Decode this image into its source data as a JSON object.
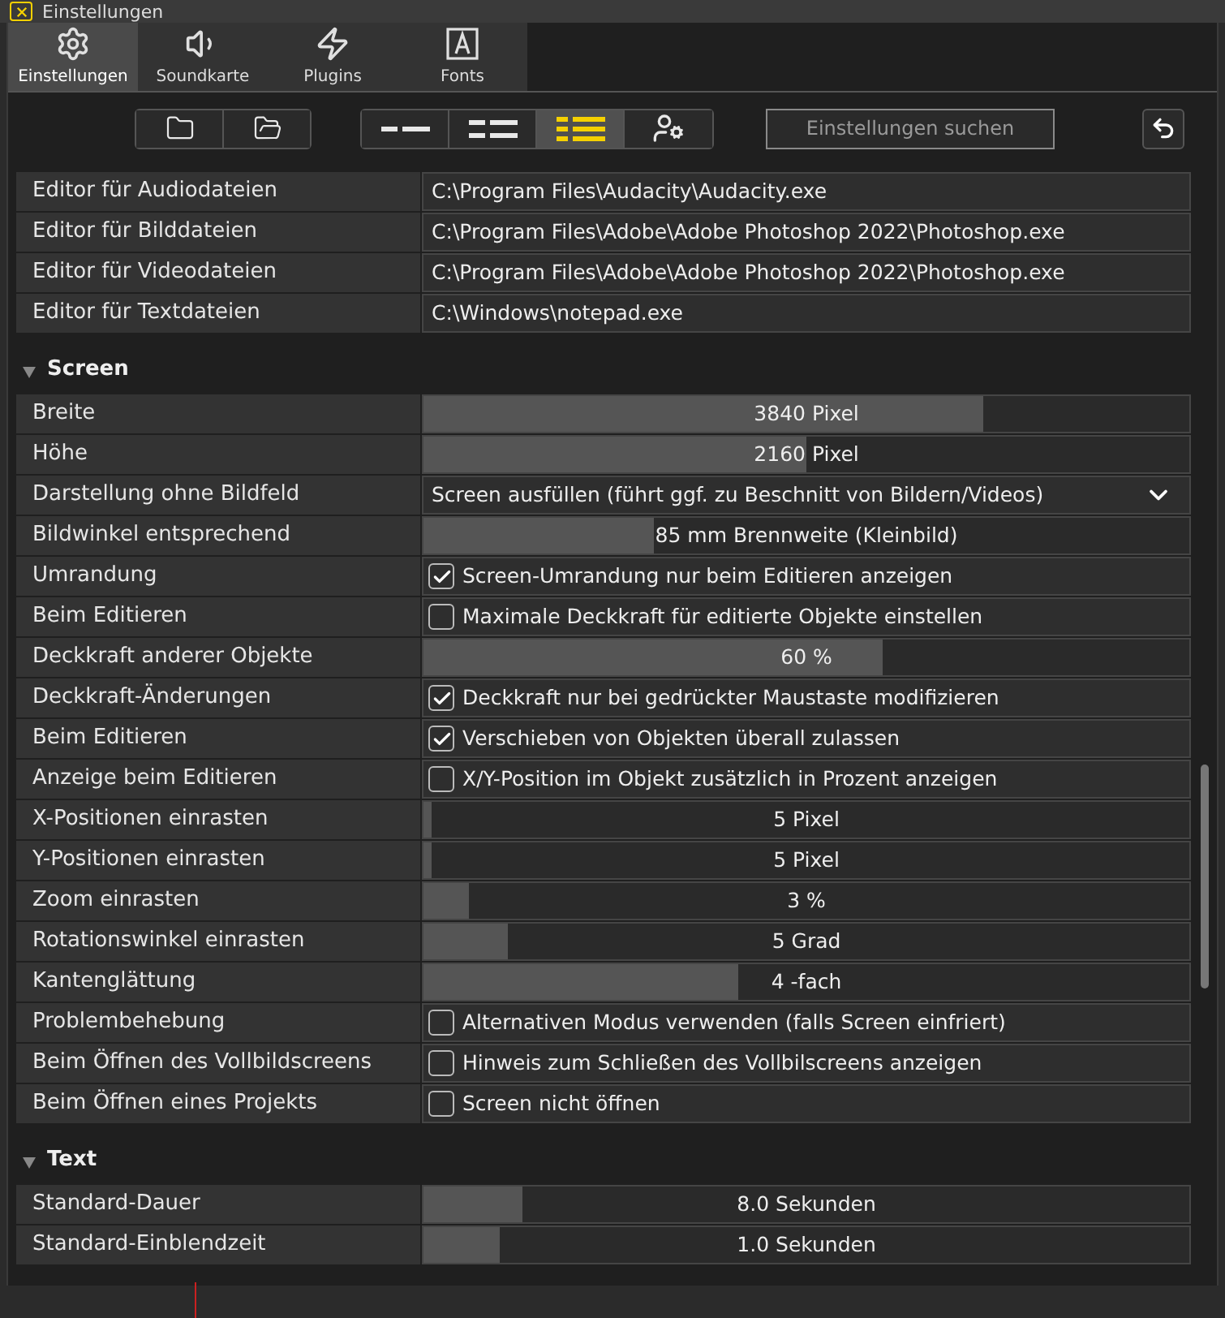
{
  "window": {
    "title": "Einstellungen"
  },
  "tabs": [
    {
      "label": "Einstellungen",
      "selected": true
    },
    {
      "label": "Soundkarte",
      "selected": false
    },
    {
      "label": "Plugins",
      "selected": false
    },
    {
      "label": "Fonts",
      "selected": false
    }
  ],
  "toolbar": {
    "view_modes": [
      {
        "selected": false
      },
      {
        "selected": false
      },
      {
        "selected": true
      },
      {
        "selected": false
      }
    ],
    "search": {
      "placeholder": "Einstellungen suchen"
    }
  },
  "sections": [
    {
      "rows": [
        {
          "kind": "text",
          "label": "Editor für Audiodateien",
          "value": "C:\\Program Files\\Audacity\\Audacity.exe"
        },
        {
          "kind": "text",
          "label": "Editor für Bilddateien",
          "value": "C:\\Program Files\\Adobe\\Adobe Photoshop 2022\\Photoshop.exe"
        },
        {
          "kind": "text",
          "label": "Editor für Videodateien",
          "value": "C:\\Program Files\\Adobe\\Adobe Photoshop 2022\\Photoshop.exe"
        },
        {
          "kind": "text",
          "label": "Editor für Textdateien",
          "value": "C:\\Windows\\notepad.exe"
        }
      ]
    },
    {
      "title": "Screen",
      "expanded": true,
      "rows": [
        {
          "kind": "slider",
          "label": "Breite",
          "value": "3840 Pixel",
          "level": 0.73
        },
        {
          "kind": "slider",
          "label": "Höhe",
          "value": "2160 Pixel",
          "level": 0.5
        },
        {
          "kind": "dropdown",
          "label": "Darstellung ohne Bildfeld",
          "value": "Screen ausfüllen (führt ggf. zu Beschnitt von Bildern/Videos)"
        },
        {
          "kind": "slider",
          "label": "Bildwinkel entsprechend",
          "value": "85 mm Brennweite (Kleinbild)",
          "level": 0.3
        },
        {
          "kind": "checkbox",
          "label": "Umrandung",
          "value": "Screen-Umrandung nur beim Editieren anzeigen",
          "checked": true
        },
        {
          "kind": "checkbox",
          "label": "Beim Editieren",
          "value": "Maximale Deckkraft für editierte Objekte einstellen",
          "checked": false
        },
        {
          "kind": "slider",
          "label": "Deckkraft anderer Objekte",
          "value": "60 %",
          "level": 0.6
        },
        {
          "kind": "checkbox",
          "label": "Deckkraft-Änderungen",
          "value": "Deckkraft nur bei gedrückter Maustaste modifizieren",
          "checked": true
        },
        {
          "kind": "checkbox",
          "label": "Beim Editieren",
          "value": "Verschieben von Objekten überall zulassen",
          "checked": true
        },
        {
          "kind": "checkbox",
          "label": "Anzeige beim Editieren",
          "value": "X/Y-Position im Objekt zusätzlich in Prozent anzeigen",
          "checked": false
        },
        {
          "kind": "slider",
          "label": "X-Positionen einrasten",
          "value": "5 Pixel",
          "level": 0.01
        },
        {
          "kind": "slider",
          "label": "Y-Positionen einrasten",
          "value": "5 Pixel",
          "level": 0.01
        },
        {
          "kind": "slider",
          "label": "Zoom einrasten",
          "value": "3 %",
          "level": 0.06
        },
        {
          "kind": "slider",
          "label": "Rotationswinkel einrasten",
          "value": "5 Grad",
          "level": 0.11
        },
        {
          "kind": "slider",
          "label": "Kantenglättung",
          "value": "4 -fach",
          "level": 0.41
        },
        {
          "kind": "checkbox",
          "label": "Problembehebung",
          "value": "Alternativen Modus verwenden (falls Screen einfriert)",
          "checked": false
        },
        {
          "kind": "checkbox",
          "label": "Beim Öffnen des Vollbildscreens",
          "value": "Hinweis zum Schließen des Vollbilscreens anzeigen",
          "checked": false
        },
        {
          "kind": "checkbox",
          "label": "Beim Öffnen eines Projekts",
          "value": "Screen nicht öffnen",
          "checked": false
        }
      ]
    },
    {
      "title": "Text",
      "expanded": true,
      "rows": [
        {
          "kind": "slider",
          "label": "Standard-Dauer",
          "value": "8.0 Sekunden",
          "level": 0.13
        },
        {
          "kind": "slider",
          "label": "Standard-Einblendzeit",
          "value": "1.0 Sekunden",
          "level": 0.1
        }
      ]
    }
  ]
}
